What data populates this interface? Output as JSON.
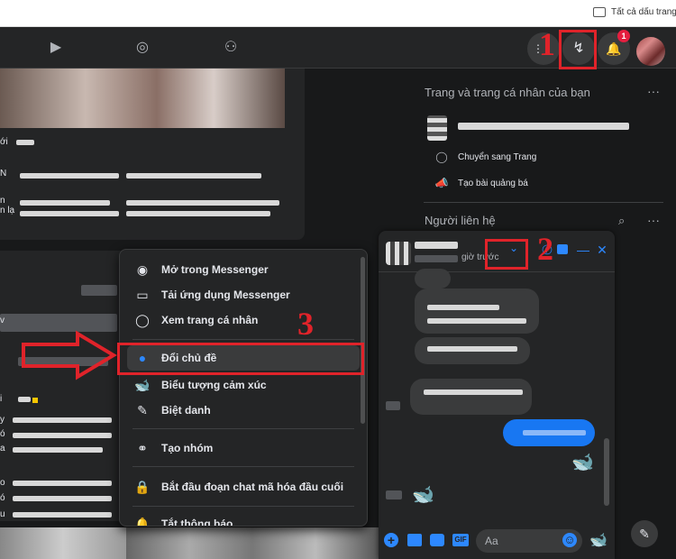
{
  "bookmarks": {
    "all_label": "Tất cả dấu trang"
  },
  "topbar": {
    "watch_icon": "▶",
    "groups_icon": "◎",
    "gaming_icon": "⚇",
    "menu_icon": "⋮⋮",
    "messenger_icon": "↯",
    "bell_icon": "🔔",
    "notif_count": "1"
  },
  "feed": {
    "snippets": [
      "ới",
      "N",
      "n",
      "n lạ",
      "a",
      "v",
      "i",
      "y",
      "ó",
      "o",
      "ó",
      "u"
    ]
  },
  "sidebar": {
    "pages_title": "Trang và trang cá nhân của bạn",
    "more_icon": "···",
    "switch_label": "Chuyển sang Trang",
    "ad_label": "Tạo bài quảng bá",
    "contacts_title": "Người liên hệ"
  },
  "chat": {
    "status": "giờ trước",
    "chevron": "⌄",
    "call_icon": "✆",
    "video_icon": "▶",
    "minimize_icon": "—",
    "close_icon": "✕",
    "emoji_whale": "🐋",
    "input_placeholder": "Aa",
    "plus_icon": "+",
    "smile_icon": "☺"
  },
  "menu": {
    "items": [
      {
        "label": "Mở trong Messenger",
        "icon": "◉"
      },
      {
        "label": "Tải ứng dụng Messenger",
        "icon": "▭"
      },
      {
        "label": "Xem trang cá nhân",
        "icon": "◯"
      },
      {
        "label": "Đổi chủ đề",
        "icon": "●"
      },
      {
        "label": "Biểu tượng cảm xúc",
        "icon": "🐋"
      },
      {
        "label": "Biệt danh",
        "icon": "✎"
      },
      {
        "label": "Tạo nhóm",
        "icon": "⚭"
      },
      {
        "label": "Bắt đầu đoạn chat mã hóa đầu cuối",
        "icon": "🔒"
      },
      {
        "label": "Tắt thông báo",
        "icon": "🔔"
      }
    ]
  },
  "annotations": {
    "n1": "1",
    "n2": "2",
    "n3": "3"
  },
  "colors": {
    "accent": "#2d88ff",
    "annotation": "#e0232a",
    "bg": "#18191a",
    "surface": "#242526"
  }
}
